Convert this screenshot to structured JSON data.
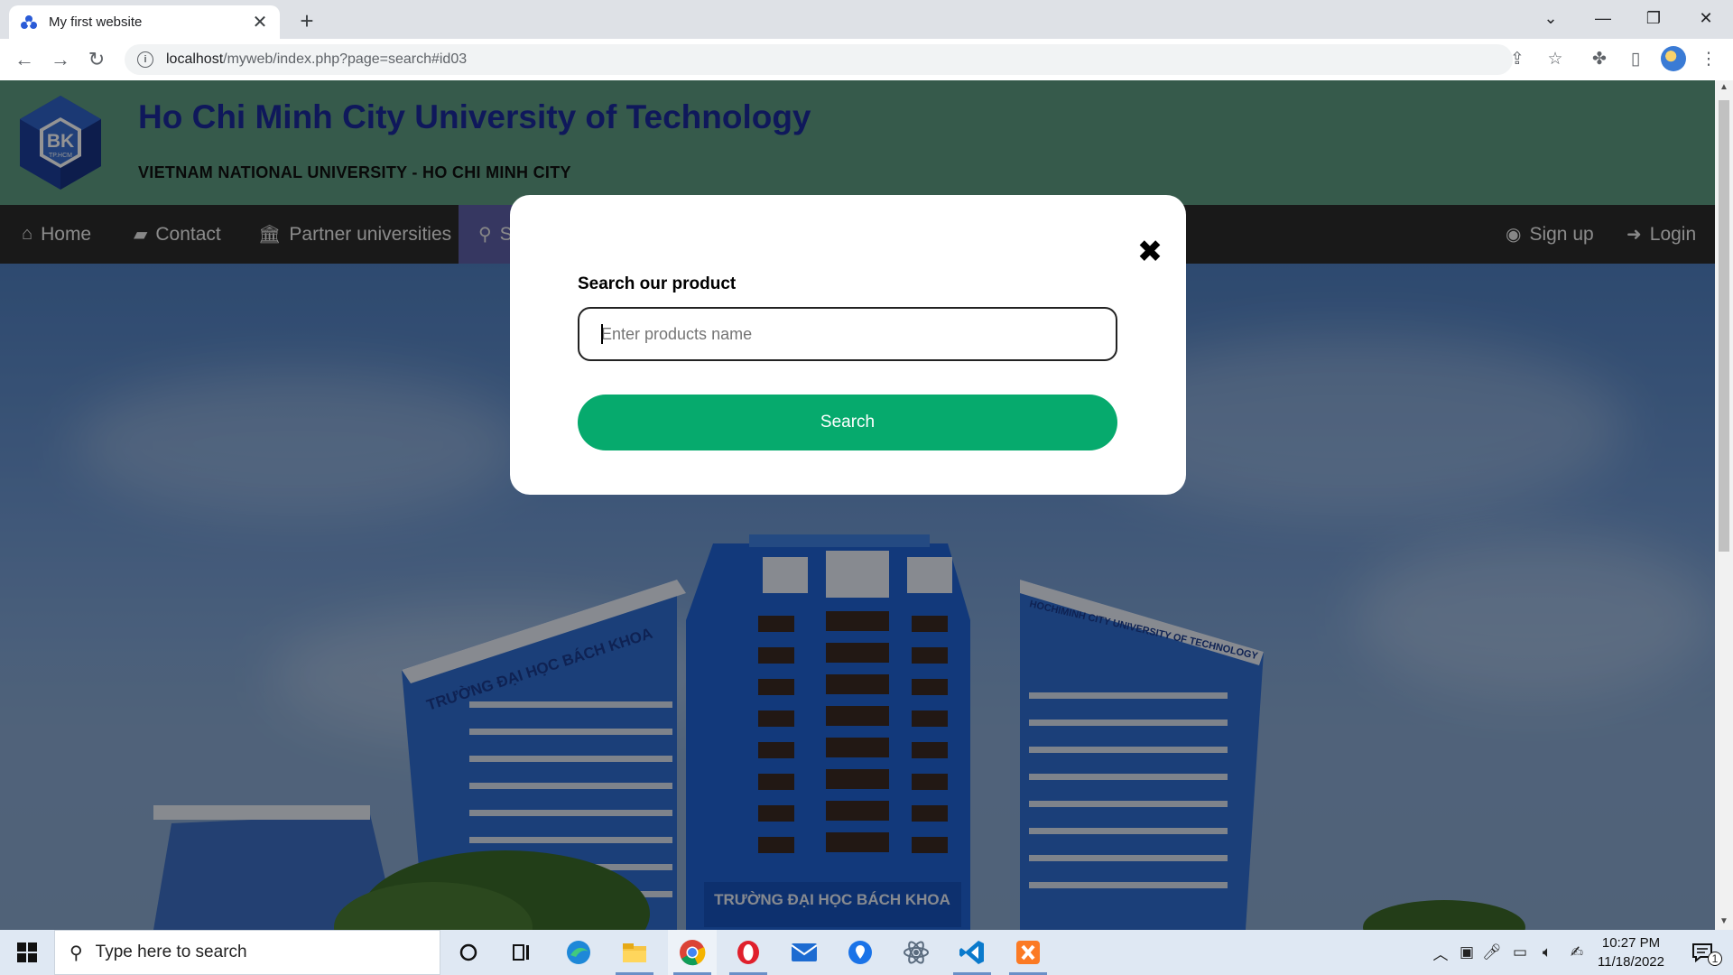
{
  "browser": {
    "tab_title": "My first website",
    "url_host": "localhost",
    "url_path": "/myweb/index.php?page=search#id03"
  },
  "site": {
    "title": "Ho Chi Minh City University of Technology",
    "subtitle": "VIETNAM NATIONAL UNIVERSITY - HO CHI MINH CITY",
    "logo_text": "BK",
    "logo_subtext": "TP.HCM"
  },
  "nav": {
    "home": "Home",
    "contact": "Contact",
    "partners": "Partner universities",
    "search": "Search",
    "signup": "Sign up",
    "login": "Login"
  },
  "hero": {
    "sign_left": "TRƯỜNG ĐẠI HỌC BÁCH KHOA",
    "sign_right": "HOCHIMINH CITY UNIVERSITY OF TECHNOLOGY",
    "sign_bottom": "TRƯỜNG ĐẠI HỌC BÁCH KHOA"
  },
  "modal": {
    "close_glyph": "✖",
    "label": "Search our product",
    "input_placeholder": "Enter products name",
    "input_value": "",
    "button_label": "Search"
  },
  "taskbar": {
    "search_placeholder": "Type here to search",
    "time": "10:27 PM",
    "date": "11/18/2022",
    "notification_count": "1"
  },
  "colors": {
    "header_bg": "#5e9b82",
    "title_color": "#1b2a9e",
    "navbar_bg": "#2b2b2b",
    "nav_active_bg": "#5e5fa8",
    "button_green": "#06aa6d"
  }
}
